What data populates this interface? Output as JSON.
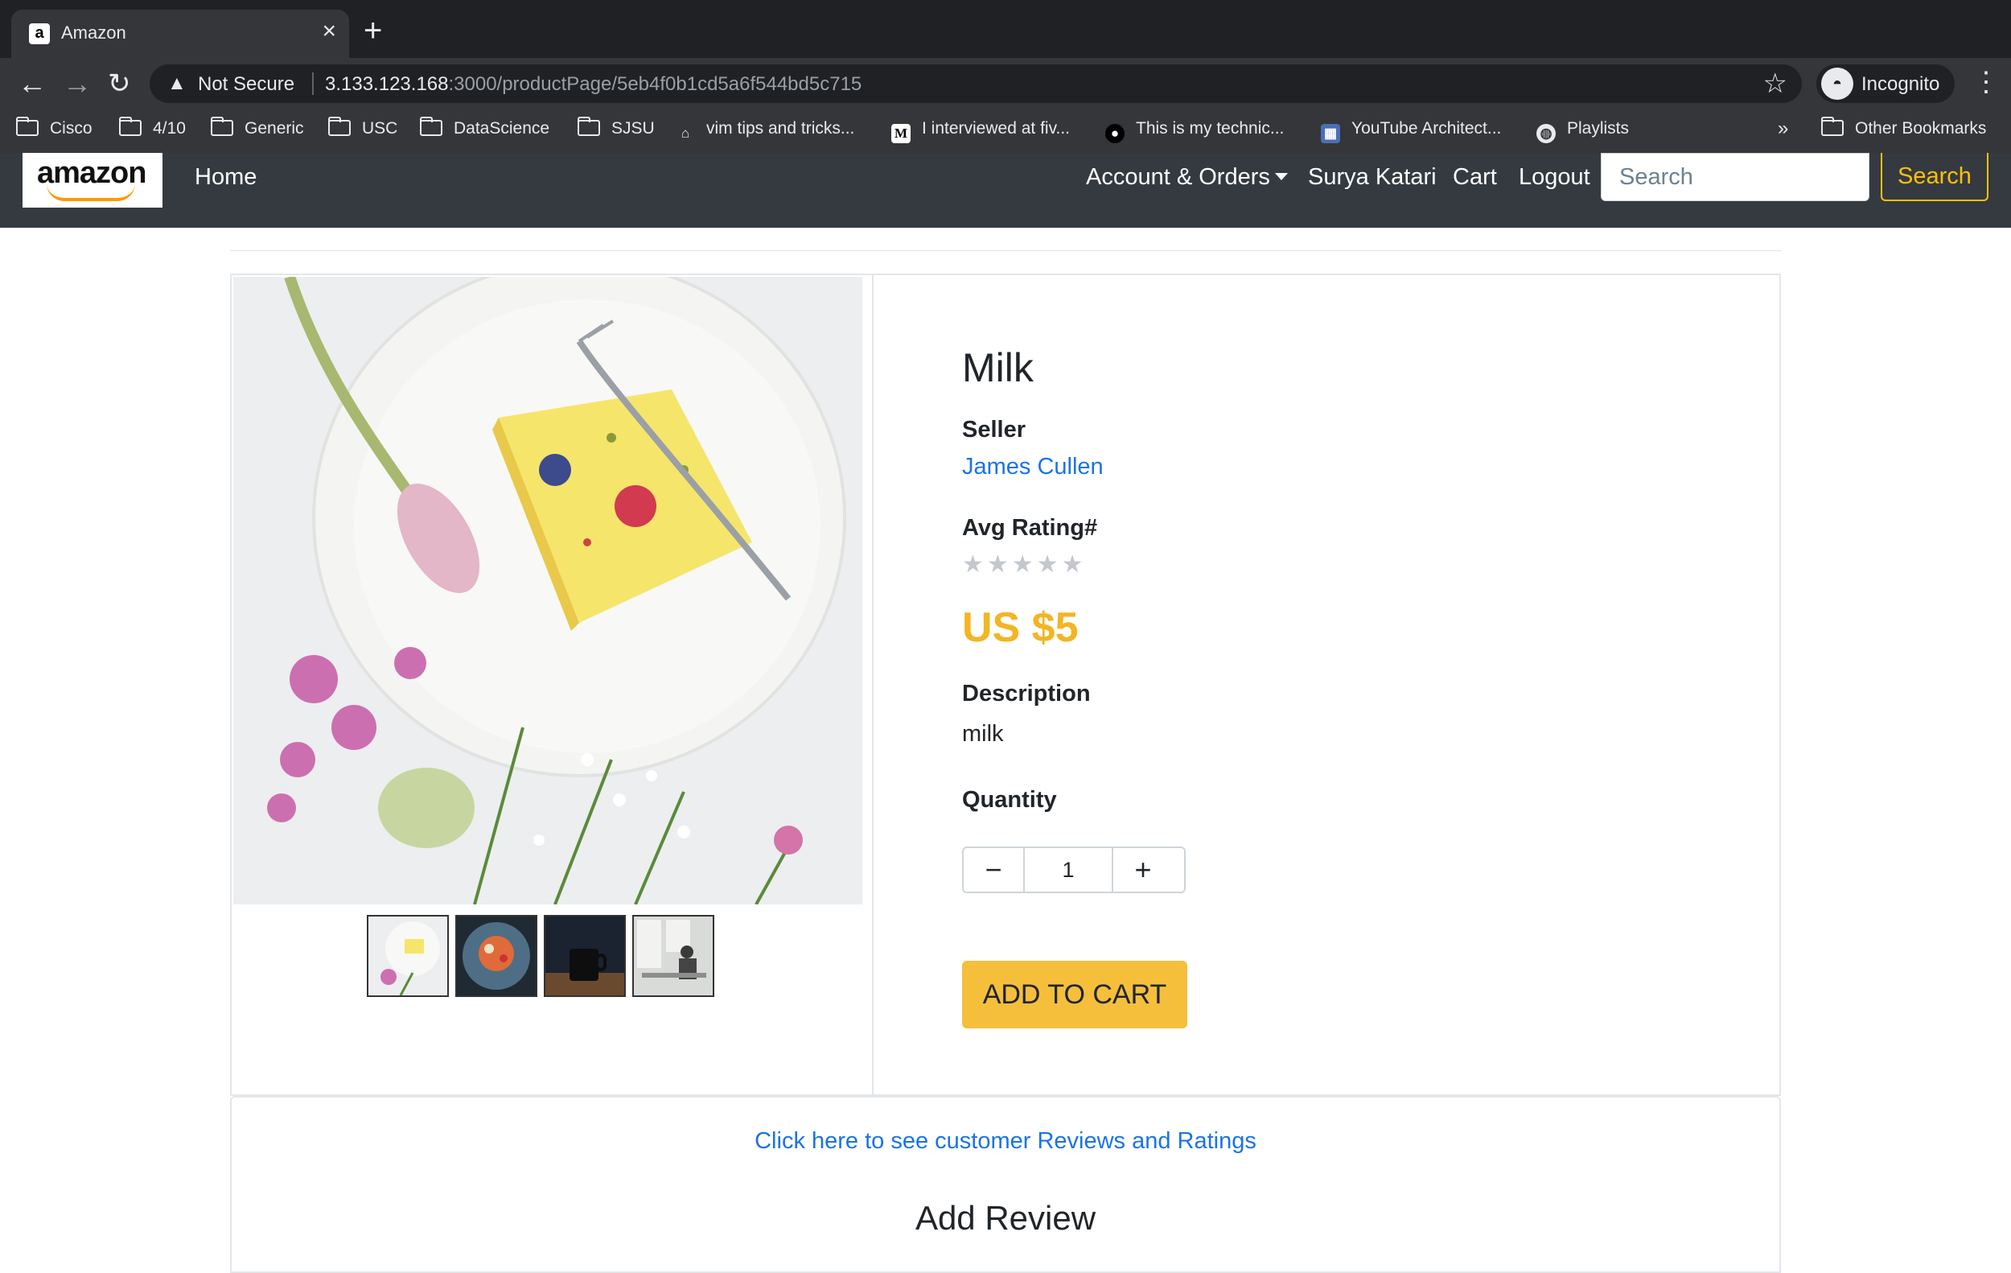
{
  "browser": {
    "tab_title": "Amazon",
    "tab_favicon": "a",
    "address": {
      "security_label": "Not Secure",
      "host": "3.133.123.168",
      "path": ":3000/productPage/5eb4f0b1cd5a6f544bd5c715"
    },
    "profile_label": "Incognito",
    "bookmarks": [
      {
        "label": "Cisco",
        "icon": "folder-icon"
      },
      {
        "label": "4/10",
        "icon": "folder-icon"
      },
      {
        "label": "Generic",
        "icon": "folder-icon"
      },
      {
        "label": "USC",
        "icon": "folder-icon"
      },
      {
        "label": "DataScience",
        "icon": "folder-icon"
      },
      {
        "label": "SJSU",
        "icon": "folder-icon"
      },
      {
        "label": "vim tips and tricks...",
        "icon": "site-icon"
      },
      {
        "label": "I interviewed at fiv...",
        "icon": "medium-icon",
        "glyph": "M"
      },
      {
        "label": "This is my technic...",
        "icon": "github-icon"
      },
      {
        "label": "YouTube Architect...",
        "icon": "site-icon"
      },
      {
        "label": "Playlists",
        "icon": "globe-icon"
      }
    ],
    "overflow_label": "»",
    "other_bookmarks": "Other Bookmarks"
  },
  "navbar": {
    "logo_text": "amazon",
    "home": "Home",
    "account": "Account & Orders",
    "user": "Surya Katari",
    "cart": "Cart",
    "logout": "Logout",
    "search_placeholder": "Search",
    "search_button": "Search"
  },
  "product": {
    "title": "Milk",
    "seller_label": "Seller",
    "seller_name": "James Cullen",
    "rating_label": "Avg Rating#",
    "rating_value": 0,
    "rating_max": 5,
    "stars": "★★★★★",
    "price": "US $5",
    "description_label": "Description",
    "description": "milk",
    "quantity_label": "Quantity",
    "quantity": "1",
    "minus": "−",
    "plus": "+",
    "add_to_cart": "ADD TO CART",
    "thumbnail_count": 4
  },
  "reviews": {
    "link": "Click here to see customer Reviews and Ratings",
    "add_review_heading": "Add Review"
  },
  "colors": {
    "navbar_bg": "#343a40",
    "accent_yellow": "#f5bf3c",
    "price_color": "#f3b524",
    "link_blue": "#1a73e8"
  }
}
